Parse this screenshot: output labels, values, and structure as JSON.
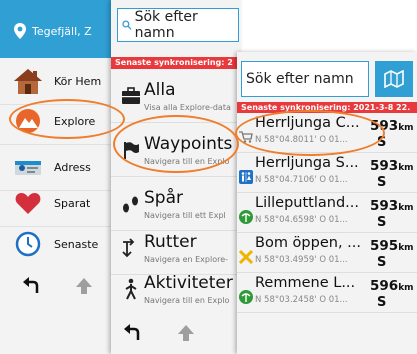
{
  "panel1": {
    "location": "Tegefjäll, Z",
    "menu": [
      {
        "label": "Kör Hem",
        "icon": "house-icon"
      },
      {
        "label": "Explore",
        "icon": "mountain-icon"
      },
      {
        "label": "Adress",
        "icon": "address-icon"
      },
      {
        "label": "Sparat",
        "icon": "heart-icon"
      },
      {
        "label": "Senaste",
        "icon": "clock-icon"
      }
    ],
    "bottom": {
      "back_icon": "back-arrow-icon",
      "up_icon": "up-arrow-icon"
    }
  },
  "panel2": {
    "search_placeholder": "Sök efter namn",
    "sync_banner": "Senaste synkronisering: 2",
    "categories": [
      {
        "title": "Alla",
        "subtitle": "Visa alla Explore-data",
        "icon": "briefcase-icon"
      },
      {
        "title": "Waypoints",
        "subtitle": "Navigera till en Explo",
        "icon": "flag-icon"
      },
      {
        "title": "Spår",
        "subtitle": "Navigera till ett Expl",
        "icon": "footprints-icon"
      },
      {
        "title": "Rutter",
        "subtitle": "Navigera en Explore-",
        "icon": "route-icon"
      },
      {
        "title": "Aktiviteter",
        "subtitle": "Navigera till en Explo",
        "icon": "hiker-icon"
      }
    ]
  },
  "panel3": {
    "search_placeholder": "Sök efter namn",
    "sync_banner": "Senaste synkronisering: 2021-3-8 22.",
    "results": [
      {
        "name": "Herrljunga C...",
        "coords": "N 58°04.8011' Ö 01...",
        "distance": "593",
        "unit": "km",
        "direction": "S",
        "icon": "shopping-cart-icon"
      },
      {
        "name": "Herrljunga S...",
        "coords": "N 58°04.7106' Ö 01...",
        "distance": "593",
        "unit": "km",
        "direction": "S",
        "icon": "restroom-icon"
      },
      {
        "name": "Lilleputtland...",
        "coords": "N 58°04.6598' Ö 01...",
        "distance": "593",
        "unit": "km",
        "direction": "S",
        "icon": "park-icon"
      },
      {
        "name": "Bom öppen, ...",
        "coords": "N 58°03.4959' Ö 01...",
        "distance": "595",
        "unit": "km",
        "direction": "S",
        "icon": "cross-icon"
      },
      {
        "name": "Remmene L...",
        "coords": "N 58°03.2458' Ö 01...",
        "distance": "596",
        "unit": "km",
        "direction": "S",
        "icon": "park-icon"
      }
    ]
  },
  "colors": {
    "accent": "#2f9fd4",
    "banner": "#e8393c",
    "highlight": "#ef7d2b"
  }
}
